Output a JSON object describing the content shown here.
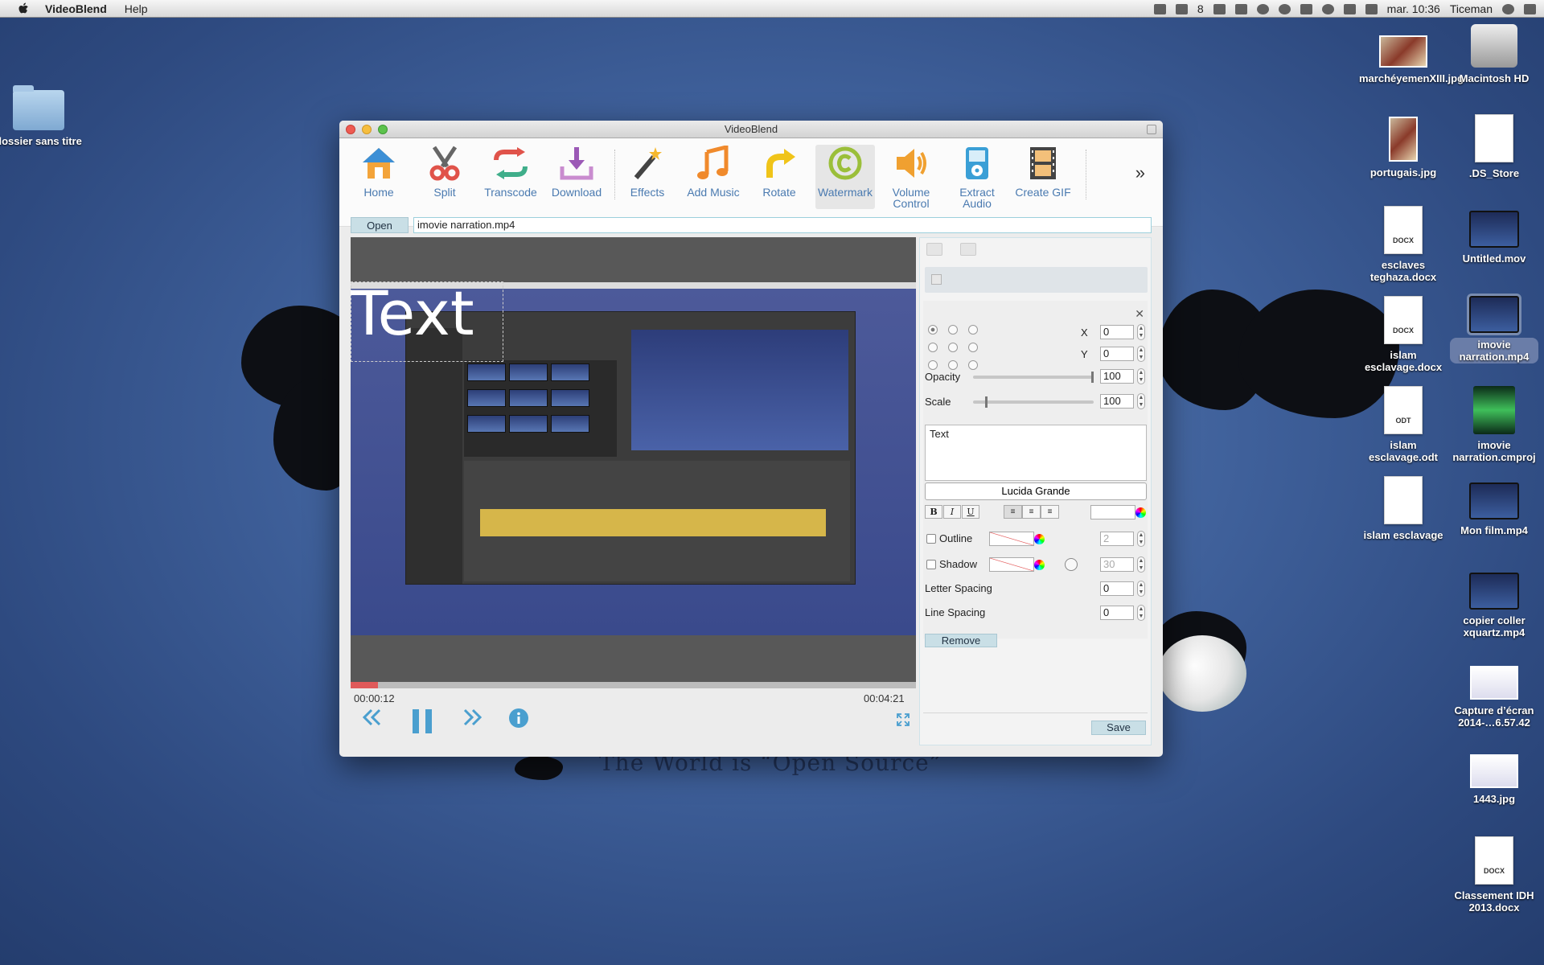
{
  "menubar": {
    "app_name": "VideoBlend",
    "menus": [
      "Help"
    ],
    "tray_badge": "8",
    "clock": "mar. 10:36",
    "user": "Ticeman"
  },
  "wallpaper": {
    "slogan": "The World is “Open Source”"
  },
  "desktop": {
    "left_items": [
      {
        "label": "dossier sans titre",
        "kind": "folder"
      }
    ],
    "right_col1": [
      {
        "label": "marchéyemenXIII.jpg",
        "kind": "image"
      },
      {
        "label": "portugais.jpg",
        "kind": "image"
      },
      {
        "label": "esclaves teghaza.docx",
        "kind": "doc",
        "tag": "DOCX"
      },
      {
        "label": "islam esclavage.docx",
        "kind": "doc",
        "tag": "DOCX"
      },
      {
        "label": "islam esclavage.odt",
        "kind": "doc",
        "tag": "ODT"
      },
      {
        "label": "islam esclavage",
        "kind": "doc",
        "tag": ""
      }
    ],
    "right_col2": [
      {
        "label": "Macintosh HD",
        "kind": "disk"
      },
      {
        "label": ".DS_Store",
        "kind": "doc",
        "tag": ""
      },
      {
        "label": "Untitled.mov",
        "kind": "video"
      },
      {
        "label": "imovie narration.mp4",
        "kind": "video",
        "selected": true
      },
      {
        "label": "imovie narration.cmproj",
        "kind": "project"
      },
      {
        "label": "Mon film.mp4",
        "kind": "video"
      },
      {
        "label": "copier coller xquartz.mp4",
        "kind": "video"
      },
      {
        "label": "Capture d’écran 2014-…6.57.42",
        "kind": "screenshot"
      },
      {
        "label": "1443.jpg",
        "kind": "screenshot"
      },
      {
        "label": "Classement IDH 2013.docx",
        "kind": "doc",
        "tag": "DOCX"
      }
    ]
  },
  "window": {
    "title": "VideoBlend",
    "toolbar": [
      {
        "label": "Home",
        "icon": "home-icon"
      },
      {
        "label": "Split",
        "icon": "scissors-icon"
      },
      {
        "label": "Transcode",
        "icon": "transcode-icon"
      },
      {
        "label": "Download",
        "icon": "download-icon"
      },
      {
        "label": "Effects",
        "icon": "magic-wand-icon"
      },
      {
        "label": "Add Music",
        "icon": "music-note-icon"
      },
      {
        "label": "Rotate",
        "icon": "rotate-icon"
      },
      {
        "label": "Watermark",
        "icon": "copyright-icon",
        "active": true
      },
      {
        "label": "Volume Control",
        "icon": "speaker-icon"
      },
      {
        "label": "Extract Audio",
        "icon": "ipod-icon"
      },
      {
        "label": "Create GIF",
        "icon": "film-strip-icon"
      }
    ],
    "more_glyph": "»",
    "open_label": "Open",
    "file_path": "imovie narration.mp4",
    "player": {
      "overlay_text": "Text",
      "progress": 0.048,
      "current_time": "00:00:12",
      "total_time": "00:04:21"
    },
    "editor": {
      "x_label": "X",
      "x_value": "0",
      "y_label": "Y",
      "y_value": "0",
      "opacity_label": "Opacity",
      "opacity_value": "100",
      "opacity_level": 1.0,
      "scale_label": "Scale",
      "scale_value": "100",
      "scale_level": 0.1,
      "text_value": "Text",
      "font_name": "Lucida Grande",
      "bold": "B",
      "italic": "I",
      "underline": "U",
      "outline_label": "Outline",
      "outline_value": "2",
      "shadow_label": "Shadow",
      "shadow_value": "30",
      "letter_spacing_label": "Letter Spacing",
      "letter_spacing_value": "0",
      "line_spacing_label": "Line Spacing",
      "line_spacing_value": "0",
      "remove_label": "Remove",
      "save_label": "Save"
    },
    "colors": {
      "accent_link": "#4a7ab0",
      "button_bg": "#c9dfe6",
      "progress": "#e05a5a"
    }
  }
}
